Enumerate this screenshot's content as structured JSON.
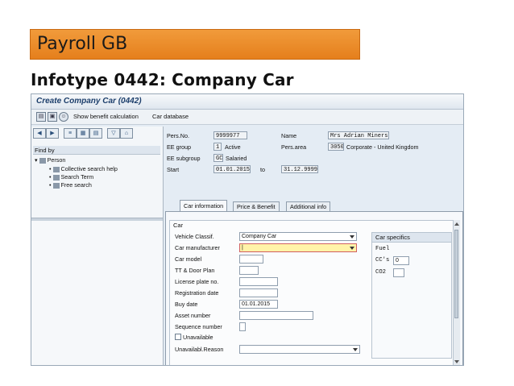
{
  "slide": {
    "banner": "Payroll GB",
    "title": "Infotype 0442: Company Car"
  },
  "window": {
    "title": "Create Company Car (0442)"
  },
  "toolbar": {
    "show_benefit": "Show benefit calculation",
    "car_database": "Car database"
  },
  "left_pane": {
    "find_by": "Find by",
    "tree": {
      "root": "Person",
      "items": [
        "Collective search help",
        "Search Term",
        "Free search"
      ]
    }
  },
  "header": {
    "pers_no_label": "Pers.No.",
    "pers_no": "9999977",
    "name_label": "Name",
    "name": "Mrs Adrian Miners",
    "ee_group_label": "EE group",
    "ee_group_code": "1",
    "ee_group_text": "Active",
    "pers_area_label": "Pers.area",
    "pers_area_code": "3050",
    "pers_area_text": "Corporate - United Kingdom",
    "ee_subgroup_label": "EE subgroup",
    "ee_subgroup_code": "GC",
    "ee_subgroup_text": "Salaried",
    "start_label": "Start",
    "start": "01.01.2015",
    "to_label": "to",
    "end": "31.12.9999"
  },
  "tabs": [
    "Car information",
    "Price & Benefit",
    "Additional info"
  ],
  "car_group": {
    "title": "Car",
    "fields": {
      "vehicle_class_label": "Vehicle Classif.",
      "vehicle_class_value": "Company Car",
      "manufacturer_label": "Car manufacturer",
      "manufacturer_value": "|",
      "model_label": "Car model",
      "tt_door_label": "TT & Door Plan",
      "license_label": "License plate no.",
      "reg_date_label": "Registration date",
      "buy_date_label": "Buy date",
      "buy_date_value": "01.01.2015",
      "asset_label": "Asset number",
      "sequence_label": "Sequence number",
      "unavailable_label": "Unavailable",
      "unavail_reason_label": "Unavailabl.Reason"
    },
    "specifics": {
      "title": "Car specifics",
      "fuel_label": "Fuel",
      "cc_label": "CC's",
      "cc_value": "0",
      "co2_label": "CO2"
    }
  }
}
